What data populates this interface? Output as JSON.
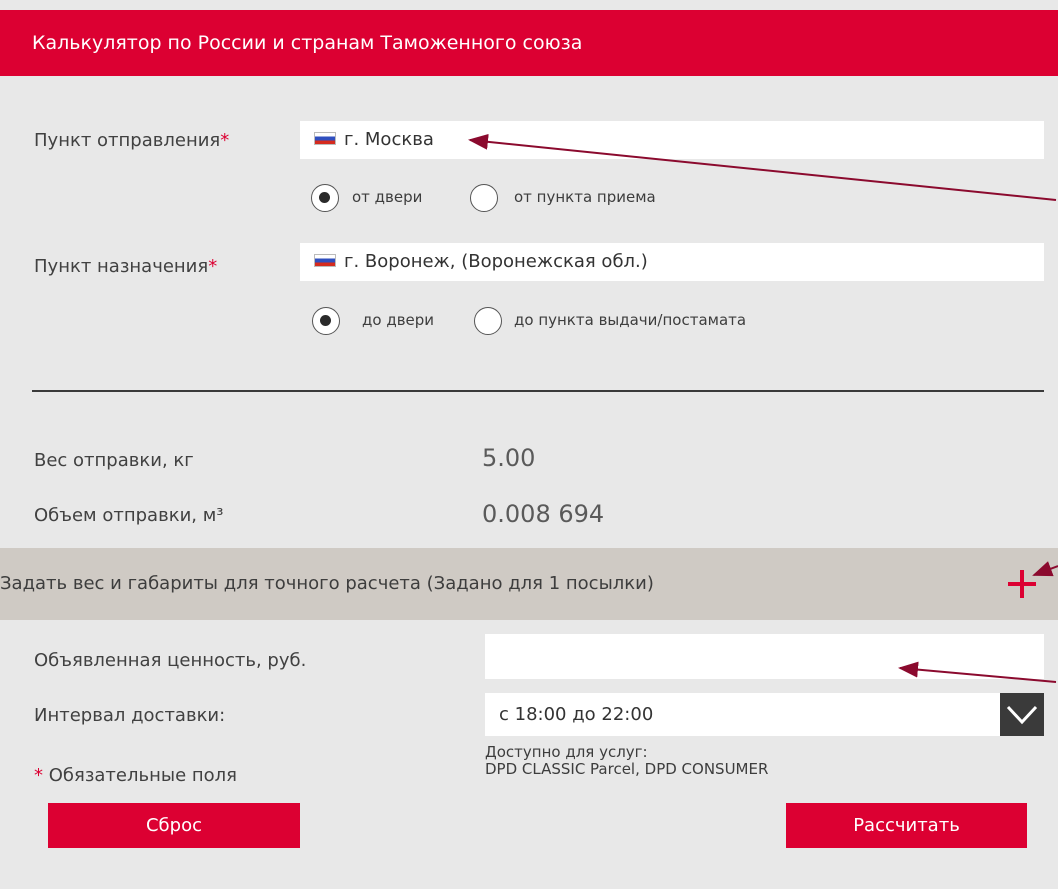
{
  "header": {
    "title": "Калькулятор по России и странам Таможенного союза"
  },
  "origin": {
    "label": "Пункт отправления",
    "required_mark": "*",
    "value": "г. Москва",
    "radios": [
      {
        "label": "от двери",
        "selected": true
      },
      {
        "label": "от пункта приема",
        "selected": false
      }
    ]
  },
  "destination": {
    "label": "Пункт назначения",
    "required_mark": "*",
    "value": "г. Воронеж, (Воронежская обл.)",
    "radios": [
      {
        "label": "до двери",
        "selected": true
      },
      {
        "label": "до пункта выдачи/постамата",
        "selected": false
      }
    ]
  },
  "weight": {
    "label": "Вес отправки, кг",
    "value": "5.00"
  },
  "volume": {
    "label": "Объем отправки, м³",
    "value": "0.008 694"
  },
  "dimensions_band": {
    "text": "Задать вес и габариты для точного расчета  (Задано для 1 посылки)",
    "icon": "plus-icon"
  },
  "declared_value": {
    "label": "Объявленная ценность, руб.",
    "value": ""
  },
  "delivery_interval": {
    "label": "Интервал доставки:",
    "selected": "с 18:00 до 22:00",
    "note_title": "Доступно для услуг:",
    "note_services": "DPD CLASSIC Parcel, DPD CONSUMER"
  },
  "required_note": {
    "mark": "*",
    "text": " Обязательные поля"
  },
  "buttons": {
    "reset": "Сброс",
    "calculate": "Рассчитать"
  },
  "colors": {
    "brand": "#dc0032",
    "band": "#cfcac4",
    "background": "#e8e8e8",
    "annotation_arrow": "#8b0a2e"
  }
}
